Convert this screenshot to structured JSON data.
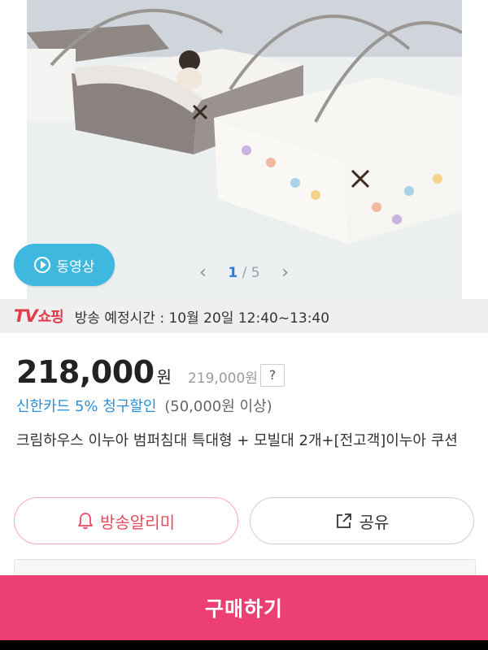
{
  "hero": {
    "video_label": "동영상",
    "pager": {
      "current": "1",
      "separator": "/",
      "total": "5",
      "prev_icon": "chevron-left-icon",
      "next_icon": "chevron-right-icon"
    }
  },
  "broadcast": {
    "logo_tv": "TV",
    "logo_shopping": "쇼핑",
    "schedule": "방송 예정시간 : 10월 20일 12:40~13:40"
  },
  "price": {
    "sale": "218,000",
    "sale_unit": "원",
    "original": "219,000원",
    "help": "?"
  },
  "card_discount": {
    "text": "신한카드 5% 청구할인",
    "condition": "(50,000원 이상)"
  },
  "product_title": "크림하우스 이누아 범퍼침대 특대형 + 모빌대 2개+[전고객]이누아 쿠션",
  "actions": {
    "alarm_label": "방송알리미",
    "share_label": "공유"
  },
  "buy_label": "구매하기",
  "colors": {
    "accent_pink": "#ec3f74",
    "video_blue": "#3fb8e0",
    "discount_blue": "#2a8fd6",
    "tv_red": "#e33b4c"
  }
}
